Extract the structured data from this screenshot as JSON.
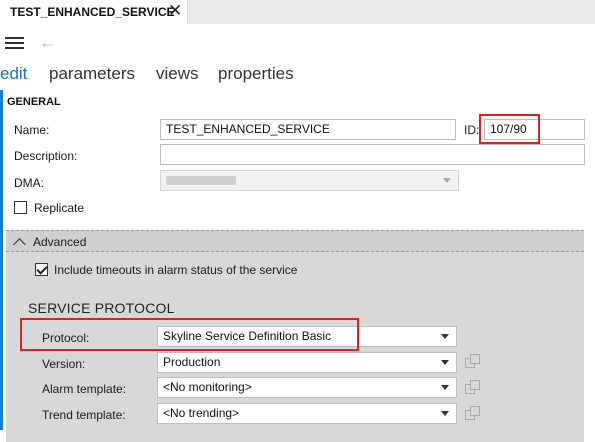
{
  "tab": {
    "title": "TEST_ENHANCED_SERVICE",
    "close_glyph": "✕"
  },
  "toolbar": {
    "menu_icon": "hamburger-icon",
    "back_icon": "back-arrow-icon",
    "back_glyph": "←"
  },
  "subtabs": [
    {
      "label": "edit",
      "active": true
    },
    {
      "label": "parameters",
      "active": false
    },
    {
      "label": "views",
      "active": false
    },
    {
      "label": "properties",
      "active": false
    }
  ],
  "general": {
    "section_title": "GENERAL",
    "name_label": "Name:",
    "name_value": "TEST_ENHANCED_SERVICE",
    "id_label": "ID:",
    "id_value": "107/90",
    "description_label": "Description:",
    "description_value": "",
    "dma_label": "DMA:",
    "replicate_label": "Replicate",
    "replicate_checked": false
  },
  "advanced": {
    "header_label": "Advanced",
    "expanded": true,
    "include_timeouts_label": "Include timeouts in alarm status of the service",
    "include_timeouts_checked": true
  },
  "service_protocol": {
    "title": "SERVICE PROTOCOL",
    "protocol_label": "Protocol:",
    "protocol_value": "Skyline Service Definition Basic",
    "version_label": "Version:",
    "version_value": "Production",
    "alarm_template_label": "Alarm template:",
    "alarm_template_value": "<No monitoring>",
    "trend_template_label": "Trend template:",
    "trend_template_value": "<No trending>"
  },
  "colors": {
    "accent": "#1c6fc4",
    "highlight": "#e02020",
    "panel": "#d8d8d8"
  }
}
